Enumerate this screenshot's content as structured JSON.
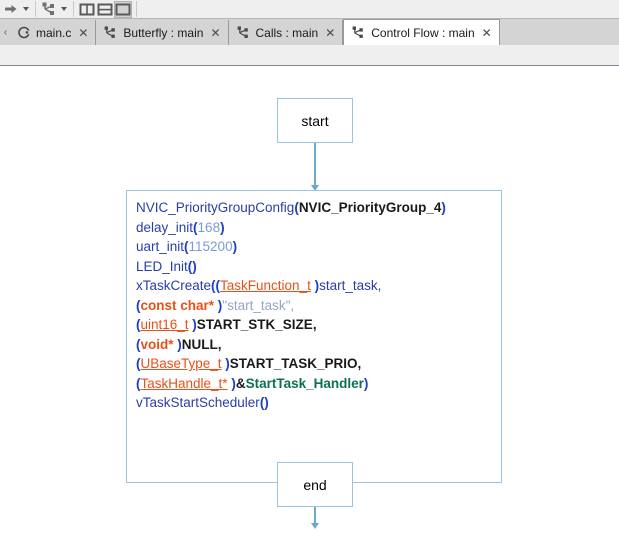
{
  "toolbar": {
    "nav_forward_label": "forward",
    "nav_forward_dropdown_label": "forward history",
    "graph_tool_label": "graph",
    "graph_tool_dropdown_label": "graph options",
    "layout_split_vertical_label": "split vertical",
    "layout_split_horizontal_label": "split horizontal",
    "layout_single_label": "single pane"
  },
  "tabs": {
    "scroll_left_label": "‹",
    "items": [
      {
        "label": "main.c",
        "icon": "c-file-icon",
        "close": "✕",
        "active": false
      },
      {
        "label": "Butterfly : main",
        "icon": "graph-icon",
        "close": "✕",
        "active": false
      },
      {
        "label": "Calls : main",
        "icon": "graph-icon",
        "close": "✕",
        "active": false
      },
      {
        "label": "Control Flow : main",
        "icon": "graph-icon",
        "close": "✕",
        "active": true
      }
    ]
  },
  "graph": {
    "start_node": {
      "label": "start"
    },
    "end_node": {
      "label": "end"
    },
    "code_node": {
      "lines": [
        {
          "parts": [
            {
              "text": "NVIC_PriorityGroupConfig",
              "style": "fn"
            },
            {
              "text": "(",
              "style": "paren"
            },
            {
              "text": "NVIC_PriorityGroup_4",
              "style": "macro"
            },
            {
              "text": ")",
              "style": "paren"
            }
          ]
        },
        {
          "parts": [
            {
              "text": "delay_init",
              "style": "fn"
            },
            {
              "text": "(",
              "style": "paren"
            },
            {
              "text": "168",
              "style": "num"
            },
            {
              "text": ")",
              "style": "paren"
            }
          ]
        },
        {
          "parts": [
            {
              "text": "uart_init",
              "style": "fn"
            },
            {
              "text": "(",
              "style": "paren"
            },
            {
              "text": "115200",
              "style": "num"
            },
            {
              "text": ")",
              "style": "paren"
            }
          ]
        },
        {
          "parts": [
            {
              "text": "LED_Init",
              "style": "fn"
            },
            {
              "text": "()",
              "style": "paren"
            }
          ]
        },
        {
          "parts": [
            {
              "text": "xTaskCreate",
              "style": "fn"
            },
            {
              "text": "((",
              "style": "paren"
            },
            {
              "text": "TaskFunction_t",
              "style": "type"
            },
            {
              "text": " )",
              "style": "paren"
            },
            {
              "text": "start_task,",
              "style": "plain"
            }
          ]
        },
        {
          "parts": [
            {
              "text": "(",
              "style": "paren"
            },
            {
              "text": "const char*",
              "style": "cast"
            },
            {
              "text": " )",
              "style": "paren"
            },
            {
              "text": "\"start_task\",",
              "style": "str"
            }
          ]
        },
        {
          "parts": [
            {
              "text": "(",
              "style": "paren"
            },
            {
              "text": "uint16_t",
              "style": "type"
            },
            {
              "text": " )",
              "style": "paren"
            },
            {
              "text": "START_STK_SIZE,",
              "style": "macro"
            }
          ]
        },
        {
          "parts": [
            {
              "text": "(",
              "style": "paren"
            },
            {
              "text": "void*",
              "style": "cast"
            },
            {
              "text": " )",
              "style": "paren"
            },
            {
              "text": "NULL,",
              "style": "macro"
            }
          ]
        },
        {
          "parts": [
            {
              "text": "(",
              "style": "paren"
            },
            {
              "text": "UBaseType_t",
              "style": "type"
            },
            {
              "text": " )",
              "style": "paren"
            },
            {
              "text": "START_TASK_PRIO,",
              "style": "macro"
            }
          ]
        },
        {
          "parts": [
            {
              "text": "(",
              "style": "paren"
            },
            {
              "text": "TaskHandle_t*",
              "style": "type"
            },
            {
              "text": " )",
              "style": "paren"
            },
            {
              "text": "&",
              "style": "sym"
            },
            {
              "text": "StartTask_Handler",
              "style": "green"
            },
            {
              "text": ")",
              "style": "paren"
            }
          ]
        },
        {
          "parts": [
            {
              "text": "vTaskStartScheduler",
              "style": "fn"
            },
            {
              "text": "()",
              "style": "paren"
            }
          ]
        }
      ]
    },
    "edges": [
      {
        "from": "start",
        "to": "code"
      },
      {
        "from": "code",
        "to": "end"
      }
    ]
  },
  "colors": {
    "node_border": "#9ec5e0",
    "edge": "#6fa8cf",
    "canvas_bg": "#ffffff",
    "chrome_bg": "#efefef",
    "tabbar_bg": "#d4d4d4",
    "active_tab_bg": "#ffffff",
    "code_default": "#2a3ea8",
    "code_cast": "#e8501a",
    "code_macro": "#1a1a1a",
    "code_green": "#0b7054",
    "code_string": "#93a7c4",
    "code_number": "#7a9bd8"
  }
}
